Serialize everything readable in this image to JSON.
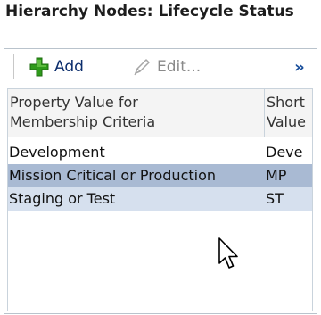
{
  "panel": {
    "title": "Hierarchy Nodes: Lifecycle Status"
  },
  "toolbar": {
    "add_label": "Add",
    "edit_label": "Edit...",
    "more_label": "»"
  },
  "table": {
    "columns": [
      {
        "line1": "Property Value for",
        "line2": "Membership Criteria"
      },
      {
        "line1": "Short",
        "line2": "Value"
      }
    ],
    "rows": [
      {
        "value": "Development",
        "short": "Deve",
        "state": "normal"
      },
      {
        "value": "Mission Critical or Production",
        "short": "MP",
        "state": "selected"
      },
      {
        "value": "Staging or Test",
        "short": "ST",
        "state": "hover"
      }
    ]
  },
  "icons": {
    "add": "plus-icon",
    "edit": "pencil-icon",
    "more": "overflow-chevron-icon",
    "pointer": "mouse-pointer-icon"
  },
  "colors": {
    "selected_row": "#a9bad3",
    "hover_row": "#d6e0ee",
    "add_icon_green": "#2f9a1b",
    "link_blue": "#0b2d6c"
  }
}
